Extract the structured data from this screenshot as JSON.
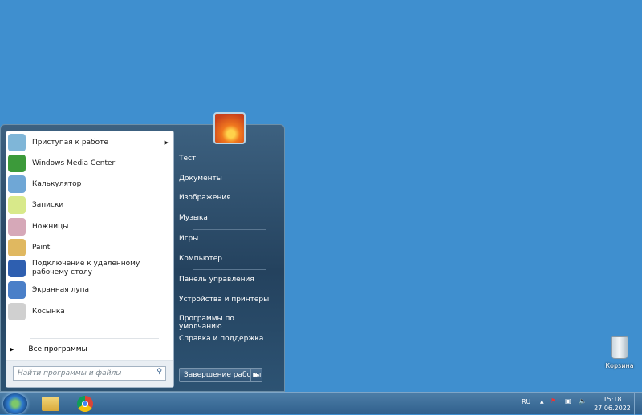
{
  "start_menu": {
    "programs": [
      {
        "label": "Приступая к работе",
        "icon": "getting-started-icon",
        "color": "#7fb6d8",
        "submenu": true
      },
      {
        "label": "Windows Media Center",
        "icon": "media-center-icon",
        "color": "#3c9a3a"
      },
      {
        "label": "Калькулятор",
        "icon": "calculator-icon",
        "color": "#6fa7d6"
      },
      {
        "label": "Записки",
        "icon": "sticky-notes-icon",
        "color": "#d8e98a"
      },
      {
        "label": "Ножницы",
        "icon": "scissors-icon",
        "color": "#d6a8b8"
      },
      {
        "label": "Paint",
        "icon": "paint-icon",
        "color": "#e0b860"
      },
      {
        "label": "Подключение к удаленному рабочему столу",
        "icon": "remote-desktop-icon",
        "color": "#2e5fb0"
      },
      {
        "label": "Экранная лупа",
        "icon": "magnifier-icon",
        "color": "#4a7fc8"
      },
      {
        "label": "Косынка",
        "icon": "solitaire-icon",
        "color": "#d0d0d0"
      }
    ],
    "all_programs": "Все программы",
    "search_placeholder": "Найти программы и файлы",
    "right_items": [
      "Тест",
      "Документы",
      "Изображения",
      "Музыка",
      "Игры",
      "Компьютер",
      "Панель управления",
      "Устройства и принтеры",
      "Программы по умолчанию",
      "Справка и поддержка"
    ],
    "shutdown": "Завершение работы"
  },
  "desktop": {
    "recycle_bin": "Корзина"
  },
  "taskbar": {
    "language": "RU",
    "time": "15:18",
    "date": "27.06.2022"
  }
}
